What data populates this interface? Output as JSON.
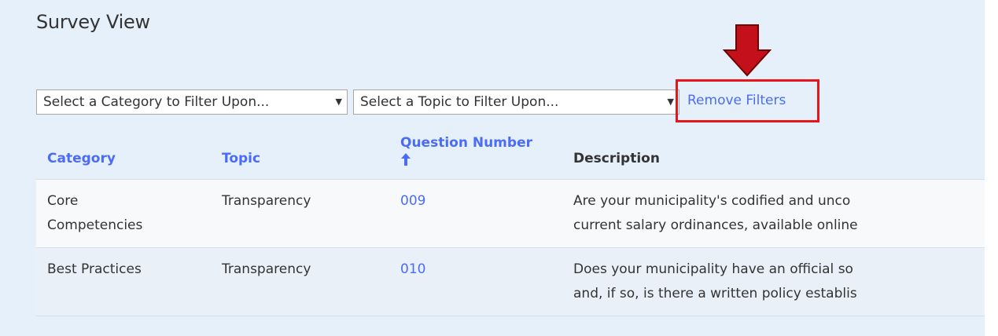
{
  "page": {
    "title": "Survey View"
  },
  "filters": {
    "category_placeholder": "Select a Category to Filter Upon...",
    "topic_placeholder": "Select a Topic to Filter Upon...",
    "remove_label": "Remove Filters"
  },
  "table": {
    "headers": {
      "category": "Category",
      "topic": "Topic",
      "question_number": "Question Number",
      "description": "Description"
    },
    "rows": [
      {
        "category": "Core",
        "category_line2": "Competencies",
        "topic": "Transparency",
        "question_number": "009",
        "description_line1": "Are your municipality's codified and unco",
        "description_line2": "current salary ordinances, available online"
      },
      {
        "category": "Best Practices",
        "category_line2": "",
        "topic": "Transparency",
        "question_number": "010",
        "description_line1": "Does your municipality have an official so",
        "description_line2": "and, if so, is there a written policy establis"
      }
    ]
  },
  "colors": {
    "panel_background": "#e6f0fb",
    "link": "#4a6cf7",
    "highlight": "#e8151b"
  },
  "icons": {
    "sort": "arrow-up-icon",
    "annotation": "red-down-arrow-icon",
    "dropdown": "caret-down-icon"
  }
}
